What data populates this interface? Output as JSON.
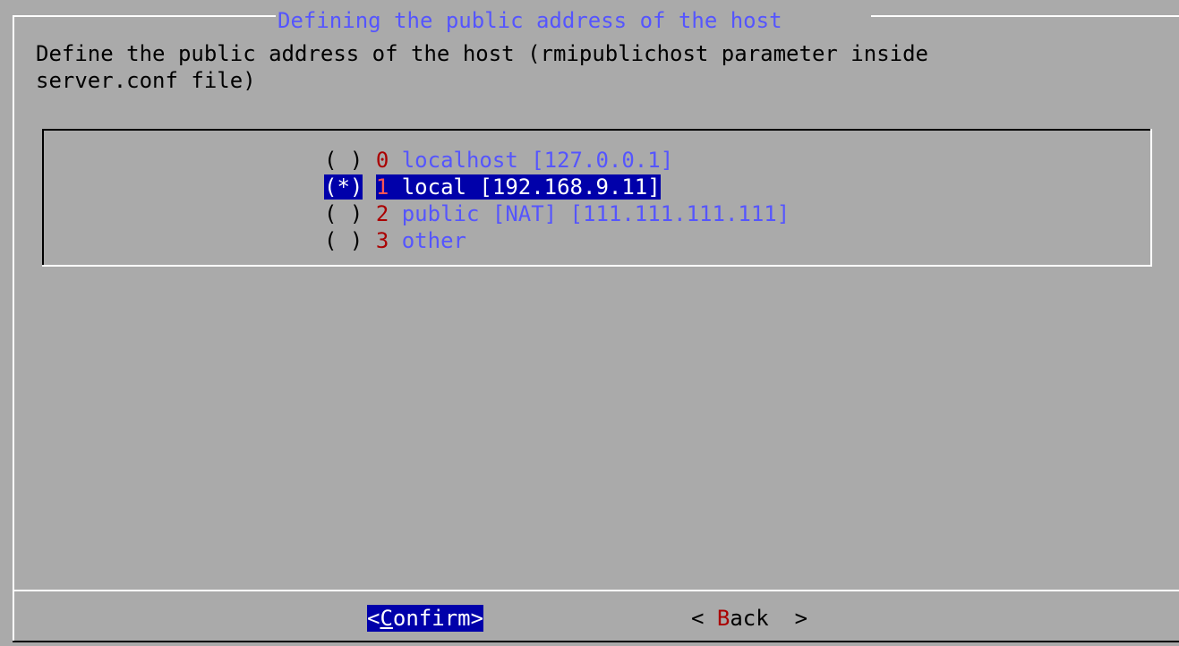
{
  "dialog": {
    "title": "Defining the public address of the host",
    "prompt_lines": [
      "Define the public address of the host (rmipublichost parameter inside",
      "server.conf file)"
    ]
  },
  "options": [
    {
      "mark": "( )",
      "tag": "0",
      "label": "localhost [127.0.0.1]",
      "selected": false
    },
    {
      "mark": "(*)",
      "tag": "1",
      "label": "local [192.168.9.11]",
      "selected": true
    },
    {
      "mark": "( )",
      "tag": "2",
      "label": "public [NAT] [111.111.111.111]",
      "selected": false
    },
    {
      "mark": "( )",
      "tag": "3",
      "label": "other",
      "selected": false
    }
  ],
  "buttons": {
    "confirm": {
      "open": "<",
      "hotkey": "C",
      "rest": "onfirm",
      "close": ">"
    },
    "back": {
      "open": "< ",
      "hotkey": "B",
      "rest": "ack",
      "close": "  >"
    }
  },
  "colors": {
    "background": "#aaaaaa",
    "selection": "#0000aa",
    "title": "#5555ff",
    "hotkey": "#aa0000"
  }
}
